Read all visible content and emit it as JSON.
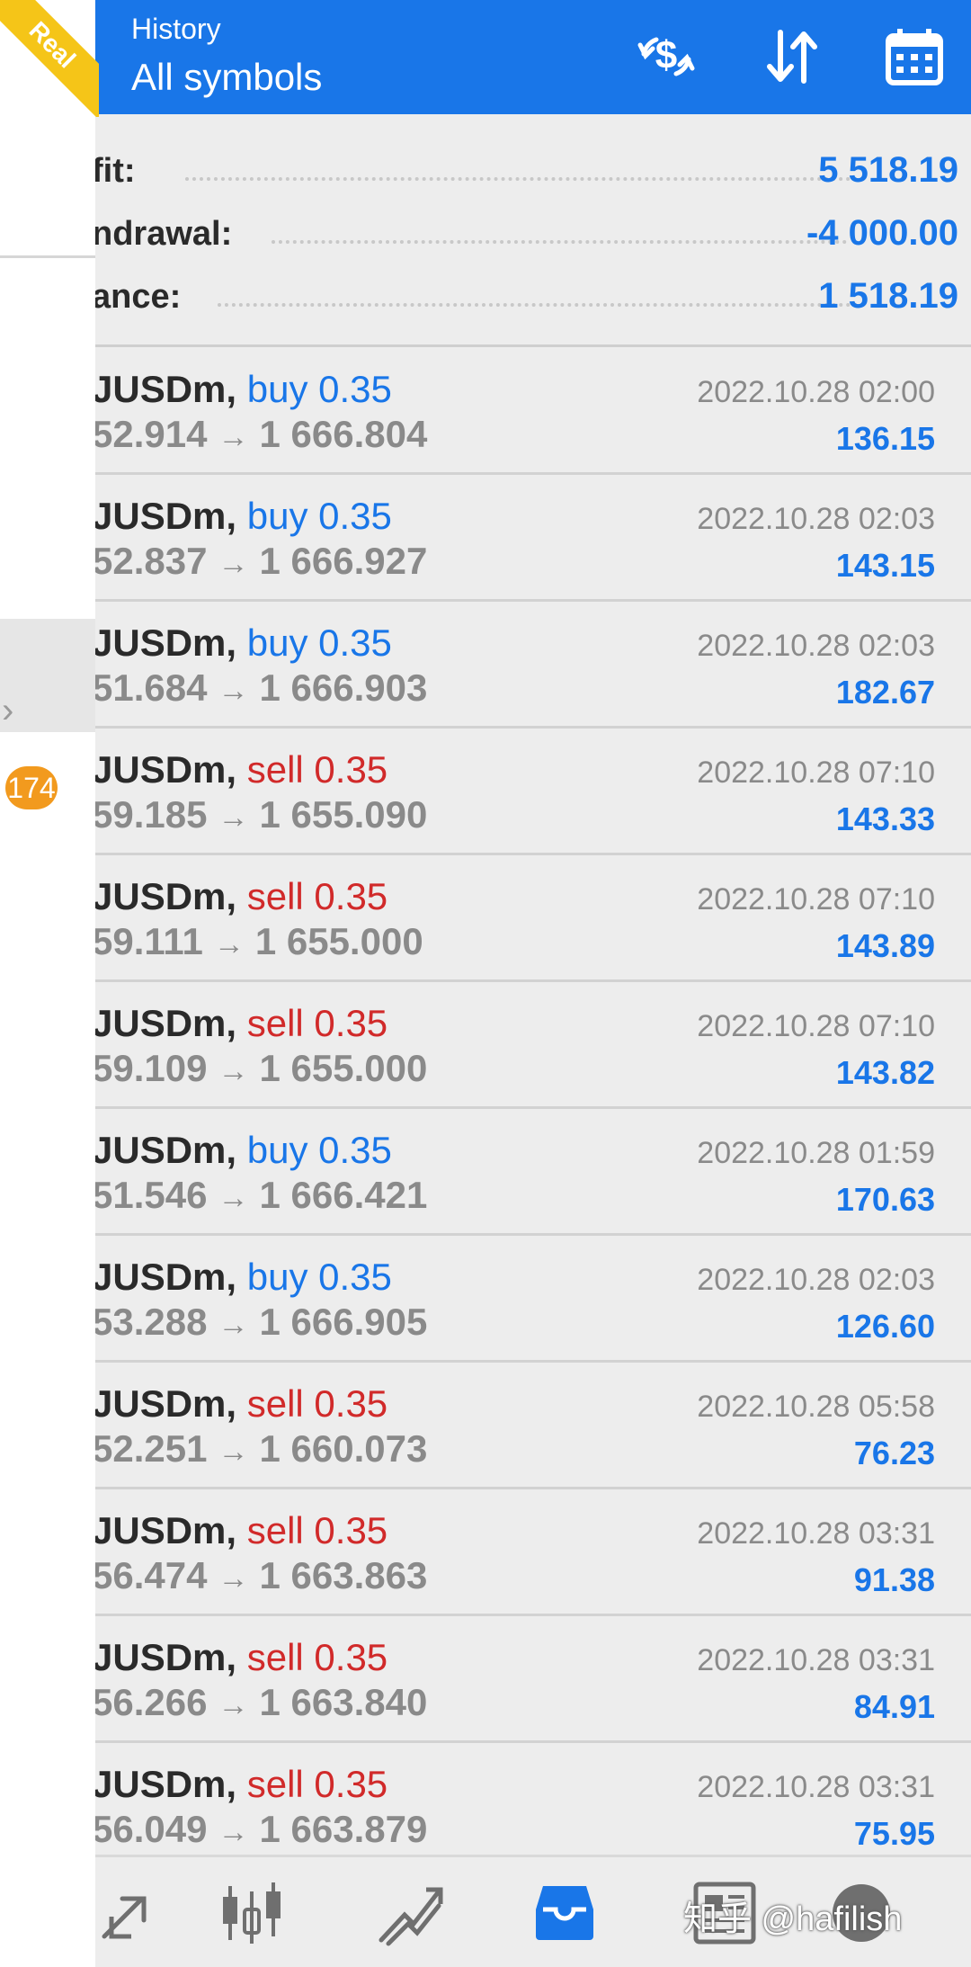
{
  "header": {
    "subtitle": "History",
    "title": "All symbols"
  },
  "badge": {
    "label": "Real"
  },
  "drawer": {
    "count": "174"
  },
  "summary": [
    {
      "label": "fit:",
      "value": "5 518.19"
    },
    {
      "label": "ndrawal:",
      "value": "-4 000.00"
    },
    {
      "label": "ance:",
      "value": "1 518.19"
    }
  ],
  "trades": [
    {
      "symbol": "JUSDm,",
      "direction": "buy 0.35",
      "type": "buy",
      "open": "52.914",
      "arrow": "→",
      "close": "1 666.804",
      "time": "2022.10.28 02:00",
      "profit": "136.15"
    },
    {
      "symbol": "JUSDm,",
      "direction": "buy 0.35",
      "type": "buy",
      "open": "52.837",
      "arrow": "→",
      "close": "1 666.927",
      "time": "2022.10.28 02:03",
      "profit": "143.15"
    },
    {
      "symbol": "JUSDm,",
      "direction": "buy 0.35",
      "type": "buy",
      "open": "51.684",
      "arrow": "→",
      "close": "1 666.903",
      "time": "2022.10.28 02:03",
      "profit": "182.67"
    },
    {
      "symbol": "JUSDm,",
      "direction": "sell 0.35",
      "type": "sell",
      "open": "59.185",
      "arrow": "→",
      "close": "1 655.090",
      "time": "2022.10.28 07:10",
      "profit": "143.33"
    },
    {
      "symbol": "JUSDm,",
      "direction": "sell 0.35",
      "type": "sell",
      "open": "59.111",
      "arrow": "→",
      "close": "1 655.000",
      "time": "2022.10.28 07:10",
      "profit": "143.89"
    },
    {
      "symbol": "JUSDm,",
      "direction": "sell 0.35",
      "type": "sell",
      "open": "59.109",
      "arrow": "→",
      "close": "1 655.000",
      "time": "2022.10.28 07:10",
      "profit": "143.82"
    },
    {
      "symbol": "JUSDm,",
      "direction": "buy 0.35",
      "type": "buy",
      "open": "51.546",
      "arrow": "→",
      "close": "1 666.421",
      "time": "2022.10.28 01:59",
      "profit": "170.63"
    },
    {
      "symbol": "JUSDm,",
      "direction": "buy 0.35",
      "type": "buy",
      "open": "53.288",
      "arrow": "→",
      "close": "1 666.905",
      "time": "2022.10.28 02:03",
      "profit": "126.60"
    },
    {
      "symbol": "JUSDm,",
      "direction": "sell 0.35",
      "type": "sell",
      "open": "52.251",
      "arrow": "→",
      "close": "1 660.073",
      "time": "2022.10.28 05:58",
      "profit": "76.23"
    },
    {
      "symbol": "JUSDm,",
      "direction": "sell 0.35",
      "type": "sell",
      "open": "56.474",
      "arrow": "→",
      "close": "1 663.863",
      "time": "2022.10.28 03:31",
      "profit": "91.38"
    },
    {
      "symbol": "JUSDm,",
      "direction": "sell 0.35",
      "type": "sell",
      "open": "56.266",
      "arrow": "→",
      "close": "1 663.840",
      "time": "2022.10.28 03:31",
      "profit": "84.91"
    },
    {
      "symbol": "JUSDm,",
      "direction": "sell 0.35",
      "type": "sell",
      "open": "56.049",
      "arrow": "→",
      "close": "1 663.879",
      "time": "2022.10.28 03:31",
      "profit": "75.95"
    }
  ],
  "nav": {
    "items": [
      "trade-arrow-icon",
      "chart-candles-icon",
      "trend-icon",
      "history-inbox-icon",
      "news-icon",
      "chat-icon"
    ],
    "active": "history-inbox-icon"
  },
  "watermark": "知乎 @hafilish",
  "colors": {
    "accent": "#1976e8",
    "sell": "#d12a2a",
    "badge": "#f5c518"
  }
}
